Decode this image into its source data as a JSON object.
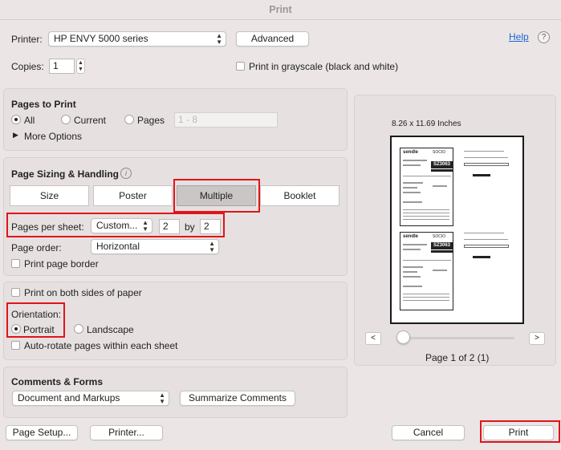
{
  "window": {
    "title": "Print"
  },
  "printer": {
    "label": "Printer:",
    "selected": "HP ENVY 5000 series",
    "advanced_label": "Advanced",
    "help_label": "Help",
    "help_symbol": "?"
  },
  "copies": {
    "label": "Copies:",
    "value": "1",
    "grayscale_label": "Print in grayscale (black and white)"
  },
  "pages_to_print": {
    "title": "Pages to Print",
    "options": [
      "All",
      "Current",
      "Pages"
    ],
    "selected": "All",
    "range_placeholder": "1 - 8",
    "more_options": "More Options"
  },
  "page_sizing": {
    "title": "Page Sizing & Handling",
    "info_symbol": "i",
    "tabs": [
      "Size",
      "Poster",
      "Multiple",
      "Booklet"
    ],
    "selected_tab": "Multiple",
    "pages_per_sheet_label": "Pages per sheet:",
    "pages_per_sheet_value": "Custom...",
    "cols": "2",
    "by_label": "by",
    "rows": "2",
    "page_order_label": "Page order:",
    "page_order_value": "Horizontal",
    "border_label": "Print page border"
  },
  "orientation": {
    "duplex_label": "Print on both sides of paper",
    "title": "Orientation:",
    "options": [
      "Portrait",
      "Landscape"
    ],
    "selected": "Portrait",
    "auto_rotate_label": "Auto-rotate pages within each sheet"
  },
  "comments": {
    "title": "Comments & Forms",
    "value": "Document and Markups",
    "summarize_label": "Summarize Comments"
  },
  "preview": {
    "paper_size": "8.26 x 11.69 Inches",
    "page_indicator": "Page 1 of 2 (1)",
    "prev_symbol": "<",
    "next_symbol": ">",
    "slider_value": 0,
    "slip": {
      "brand": "sendle",
      "brand2": "SOCIO",
      "code": "SZ3063"
    }
  },
  "footer": {
    "page_setup": "Page Setup...",
    "printer": "Printer...",
    "cancel": "Cancel",
    "print": "Print"
  },
  "colors": {
    "highlight": "#e0141a",
    "link": "#1a64d6",
    "background": "#ebe6e5"
  }
}
